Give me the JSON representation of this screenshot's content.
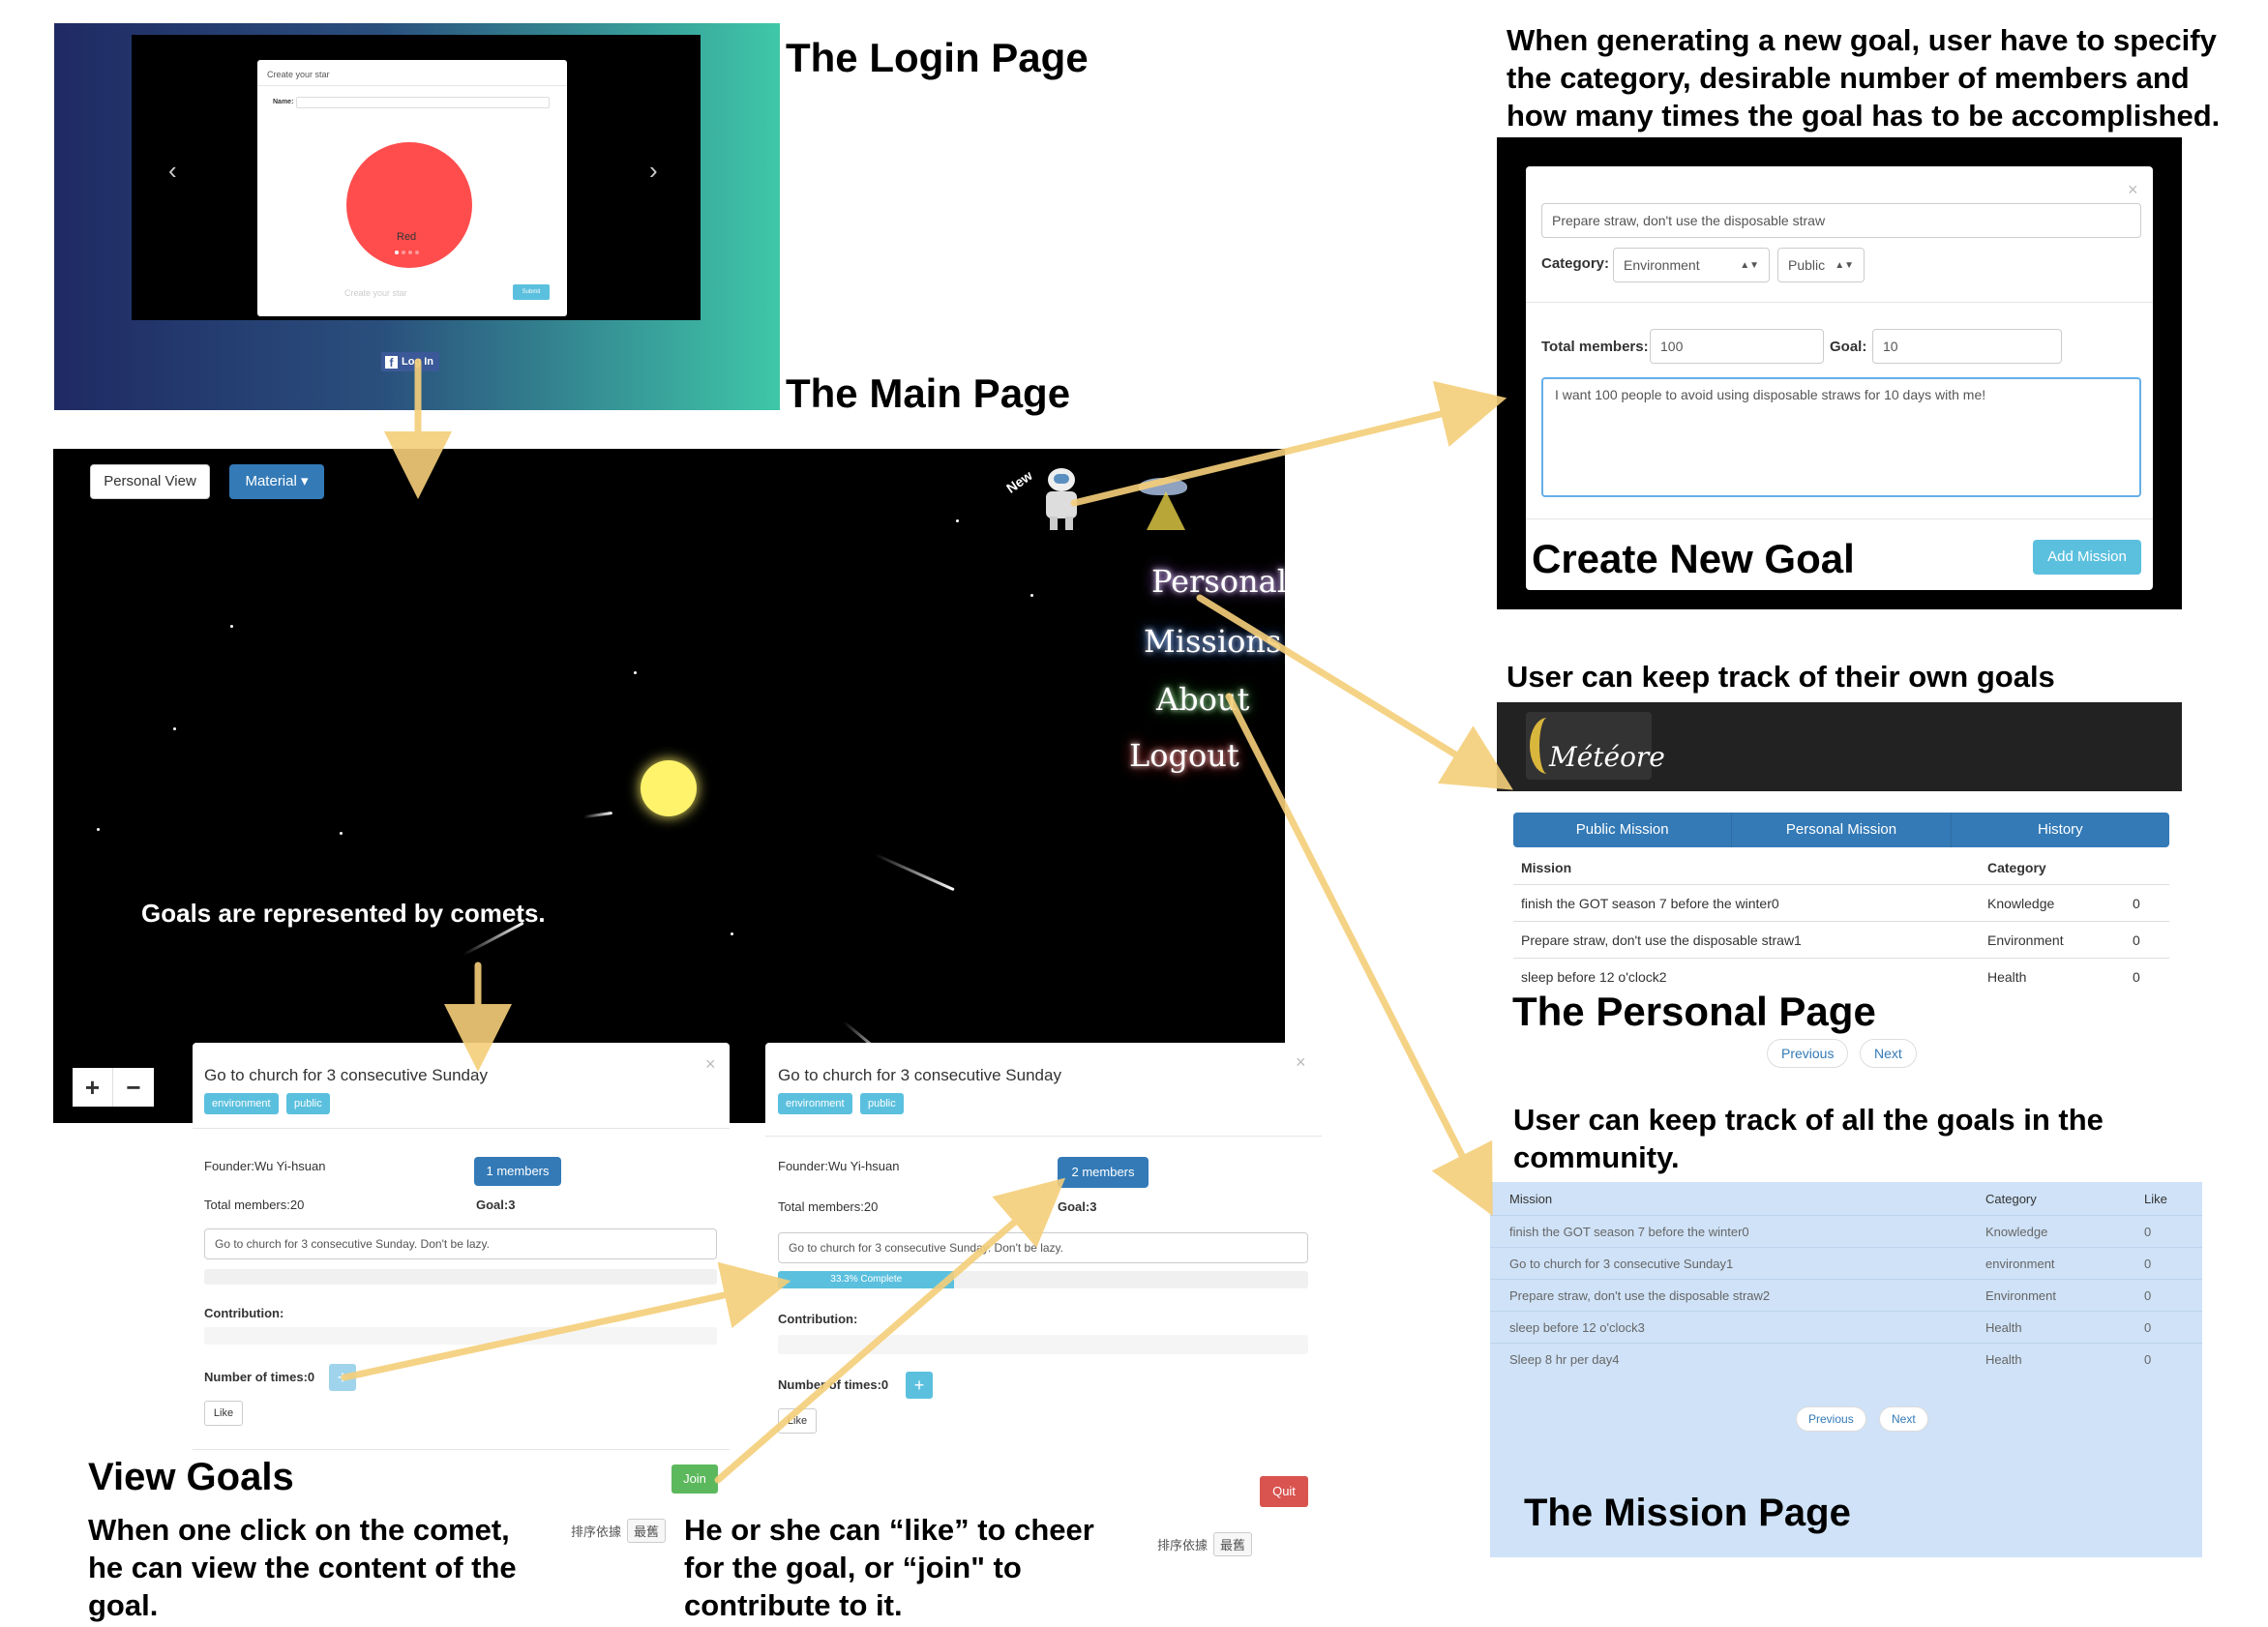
{
  "captions": {
    "login": "The Login Page",
    "main": "The Main Page",
    "create_desc": "When generating a new goal, user have to specify the category, desirable number of members and how many times the goal has to be accomplished.",
    "create_title": "Create New Goal",
    "personal_desc": "User can keep track of their own goals",
    "personal_title": "The Personal Page",
    "mission_desc": "User can keep track of all the goals in the community.",
    "mission_title": "The Mission Page",
    "comets": "Goals are represented by comets.",
    "view_title": "View Goals",
    "view_desc": "When one click on the comet, he can view the content of the goal.",
    "like_desc": "He or she can “like” to cheer for the goal, or “join\" to contribute to it."
  },
  "login": {
    "modal_title": "Create your star",
    "name_label": "Name:",
    "star_label": "Red",
    "input_placeholder": "Create your star",
    "submit": "Submit",
    "fb_button": "Log In",
    "prev_glyph": "‹",
    "next_glyph": "›"
  },
  "main": {
    "personal_view": "Personal View",
    "material": "Material ▾",
    "new_badge": "New",
    "menu": [
      "Personal",
      "Missions",
      "About",
      "Logout"
    ],
    "zoom_in": "+",
    "zoom_out": "−"
  },
  "create": {
    "goal_text": "Prepare straw, don't use the disposable straw",
    "category_label": "Category:",
    "category_value": "Environment",
    "visibility_value": "Public",
    "total_label": "Total members:",
    "total_value": "100",
    "goal_label": "Goal:",
    "goal_value": "10",
    "description": "I want 100 people to avoid using disposable straws for 10 days with me!",
    "add_button": "Add Mission",
    "close": "×"
  },
  "personal": {
    "logo": "Météore",
    "tabs": [
      "Public Mission",
      "Personal Mission",
      "History"
    ],
    "col_mission": "Mission",
    "col_category": "Category",
    "rows": [
      {
        "mission": "finish the GOT season 7 before the winter0",
        "category": "Knowledge",
        "like": "0"
      },
      {
        "mission": "Prepare straw, don't use the disposable straw1",
        "category": "Environment",
        "like": "0"
      },
      {
        "mission": "sleep before 12 o'clock2",
        "category": "Health",
        "like": "0"
      }
    ],
    "previous": "Previous",
    "next": "Next"
  },
  "mission": {
    "col_mission": "Mission",
    "col_category": "Category",
    "col_like": "Like",
    "rows": [
      {
        "mission": "finish the GOT season 7 before the winter0",
        "category": "Knowledge",
        "like": "0"
      },
      {
        "mission": "Go to church for 3 consecutive Sunday1",
        "category": "environment",
        "like": "0"
      },
      {
        "mission": "Prepare straw, don't use the disposable straw2",
        "category": "Environment",
        "like": "0"
      },
      {
        "mission": "sleep before 12 o'clock3",
        "category": "Health",
        "like": "0"
      },
      {
        "mission": "Sleep 8 hr per day4",
        "category": "Health",
        "like": "0"
      }
    ],
    "previous": "Previous",
    "next": "Next"
  },
  "goal_a": {
    "title": "Go to church for 3 consecutive Sunday",
    "tags": [
      "environment",
      "public"
    ],
    "founder": "Founder:Wu Yi-hsuan",
    "members_button": "1 members",
    "total_members": "Total members:20",
    "goal": "Goal:3",
    "description": "Go to church for 3 consecutive Sunday. Don't be lazy.",
    "contribution_label": "Contribution:",
    "times_label": "Number of times:0",
    "plus": "+",
    "like_button": "Like",
    "join_button": "Join",
    "sort_label": "排序依據",
    "sort_value": "最舊",
    "close": "×"
  },
  "goal_b": {
    "title": "Go to church for 3 consecutive Sunday",
    "tags": [
      "environment",
      "public"
    ],
    "founder": "Founder:Wu Yi-hsuan",
    "members_button": "2 members",
    "total_members": "Total members:20",
    "goal": "Goal:3",
    "description": "Go to church for 3 consecutive Sunday. Don't be lazy.",
    "progress_text": "33.3% Complete",
    "progress_fraction": 0.333,
    "contribution_label": "Contribution:",
    "times_label": "Number of times:0",
    "plus": "+",
    "like_button": "Like",
    "quit_button": "Quit",
    "sort_label": "排序依據",
    "sort_value": "最舊",
    "close": "×"
  },
  "colors": {
    "arrow": "#f5cf7a",
    "primary": "#337ab7",
    "info": "#5bc0de",
    "success": "#5cb85c",
    "danger": "#d9534f",
    "mission_bg": "#cfe2f7",
    "sun": "#fff36b",
    "star": "#ff4d4d"
  }
}
